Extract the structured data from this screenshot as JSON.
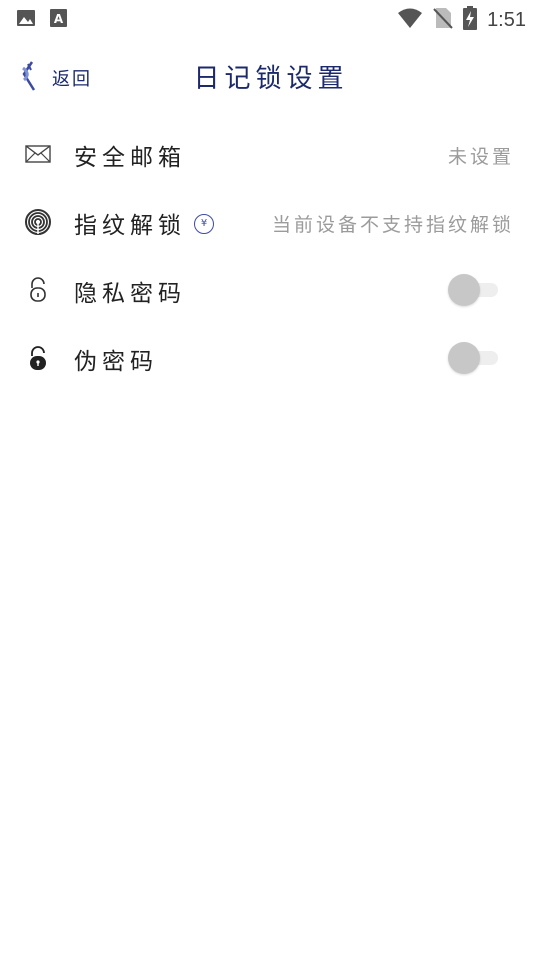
{
  "status_bar": {
    "time": "1:51"
  },
  "header": {
    "back_label": "返回",
    "title": "日记锁设置"
  },
  "settings": [
    {
      "label": "安全邮箱",
      "value": "未设置"
    },
    {
      "label": "指纹解锁",
      "hint_icon": "yen-circle-icon",
      "value": "当前设备不支持指纹解锁"
    },
    {
      "label": "隐私密码",
      "toggle_on": false
    },
    {
      "label": "伪密码",
      "toggle_on": false
    }
  ],
  "colors": {
    "accent": "#1c2a6b",
    "muted_text": "#9b9b9b",
    "toggle_off": "#c7c7c7"
  }
}
